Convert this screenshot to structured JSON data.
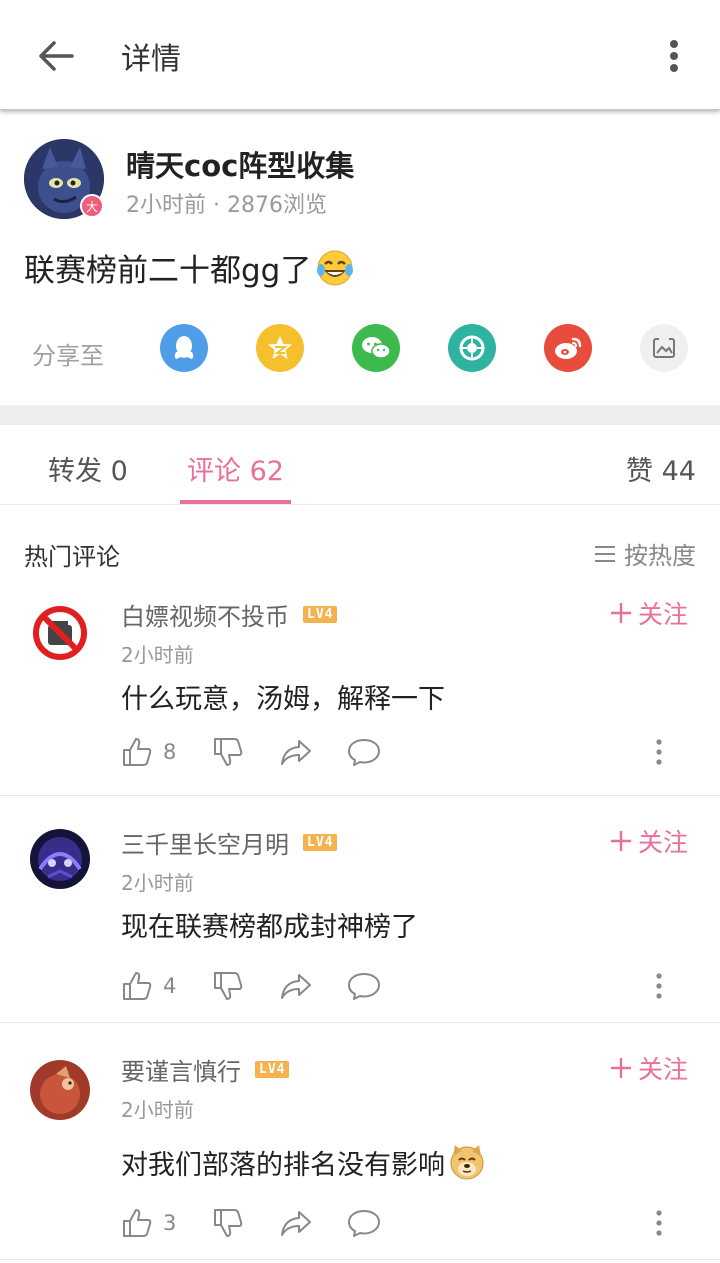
{
  "appbar": {
    "title": "详情"
  },
  "post": {
    "author_name": "晴天coc阵型收集",
    "author_badge": "大",
    "meta": "2小时前 · 2876浏览",
    "content": "联赛榜前二十都gg了",
    "share_label": "分享至",
    "share_targets": [
      "qq-icon",
      "qzone-icon",
      "wechat-icon",
      "moments-icon",
      "weibo-icon",
      "image-icon"
    ],
    "colors": {
      "qq": "#4f9de8",
      "qzone": "#f5c02c",
      "wechat": "#3dba4e",
      "moments": "#2db39f",
      "weibo": "#e74c3c",
      "image": "#f0f0f0"
    }
  },
  "tabs": {
    "repost": "转发 0",
    "comments": "评论 62",
    "likes": "赞 44"
  },
  "section": {
    "title": "热门评论",
    "sort_label": "按热度"
  },
  "comments": [
    {
      "name": "白嫖视频不投币",
      "level": "LV4",
      "follow": "关注",
      "time": "2小时前",
      "text": "什么玩意，汤姆，解释一下",
      "likes": "8"
    },
    {
      "name": "三千里长空月明",
      "level": "LV4",
      "follow": "关注",
      "time": "2小时前",
      "text": "现在联赛榜都成封神榜了",
      "likes": "4"
    },
    {
      "name": "要谨言慎行",
      "level": "LV4",
      "follow": "关注",
      "time": "2小时前",
      "text": "对我们部落的排名没有影响",
      "likes": "3"
    }
  ],
  "accent_color": "#e8709a"
}
